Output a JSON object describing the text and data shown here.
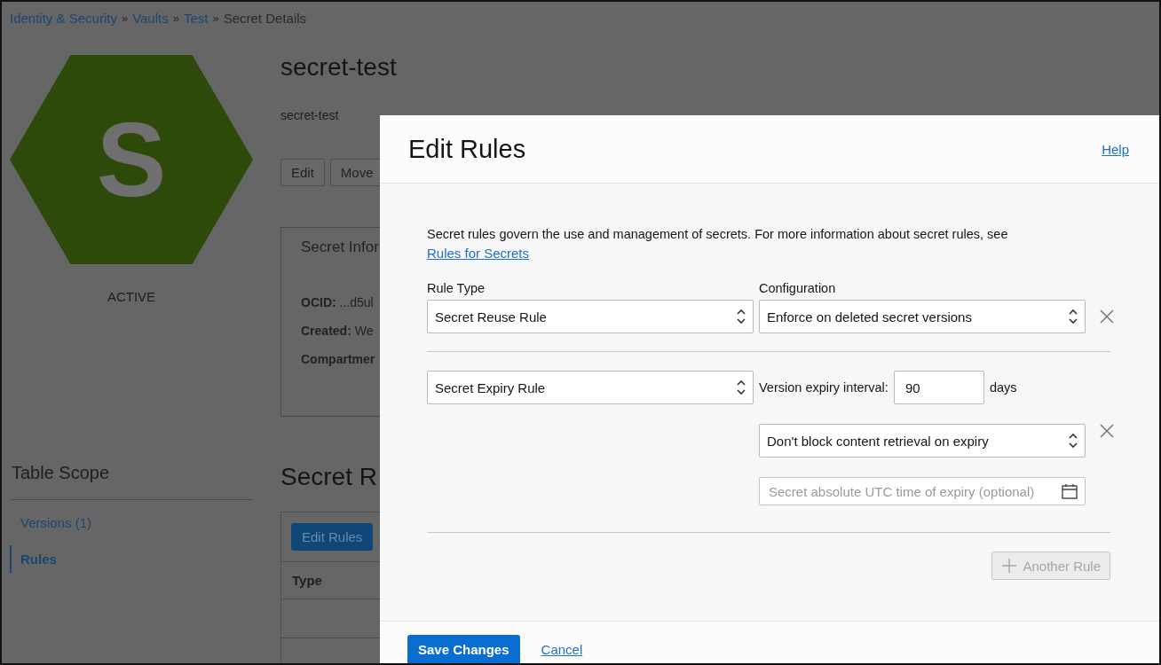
{
  "breadcrumb": [
    {
      "label": "Identity & Security",
      "link": true
    },
    {
      "label": "Vaults",
      "link": true
    },
    {
      "label": "Test",
      "link": true
    },
    {
      "label": "Secret Details",
      "link": false
    }
  ],
  "breadcrumb_separator": "»",
  "resource": {
    "letter": "S",
    "status": "ACTIVE",
    "title": "secret-test",
    "subtitle": "secret-test",
    "buttons": [
      "Edit",
      "Move"
    ]
  },
  "info_panel": {
    "title": "Secret Infor",
    "fields": [
      {
        "label": "OCID:",
        "value": "...d5ul"
      },
      {
        "label": "Created:",
        "value": "We"
      },
      {
        "label": "Compartmer"
      }
    ]
  },
  "table_scope": {
    "title": "Table Scope",
    "items": [
      {
        "label": "Versions (1)",
        "selected": false
      },
      {
        "label": "Rules",
        "selected": true
      }
    ]
  },
  "rules_section": {
    "title": "Secret R",
    "button": "Edit Rules",
    "columns": [
      "Type"
    ]
  },
  "modal": {
    "title": "Edit Rules",
    "help": "Help",
    "description": "Secret rules govern the use and management of secrets. For more information about secret rules, see ",
    "description_link": "Rules for Secrets",
    "headers": [
      "Rule Type",
      "Configuration"
    ],
    "rules": [
      {
        "kind": "reuse",
        "type": "Secret Reuse Rule",
        "configuration": "Enforce on deleted secret versions"
      },
      {
        "kind": "expiry",
        "type": "Secret Expiry Rule",
        "interval_label": "Version expiry interval:",
        "interval_value": "90",
        "interval_unit": "days",
        "configuration": "Don't block content retrieval on expiry",
        "date_placeholder": "Secret absolute UTC time of expiry (optional)"
      }
    ],
    "add_button": {
      "label": "Another Rule",
      "disabled": true
    },
    "save": "Save Changes",
    "cancel": "Cancel"
  }
}
